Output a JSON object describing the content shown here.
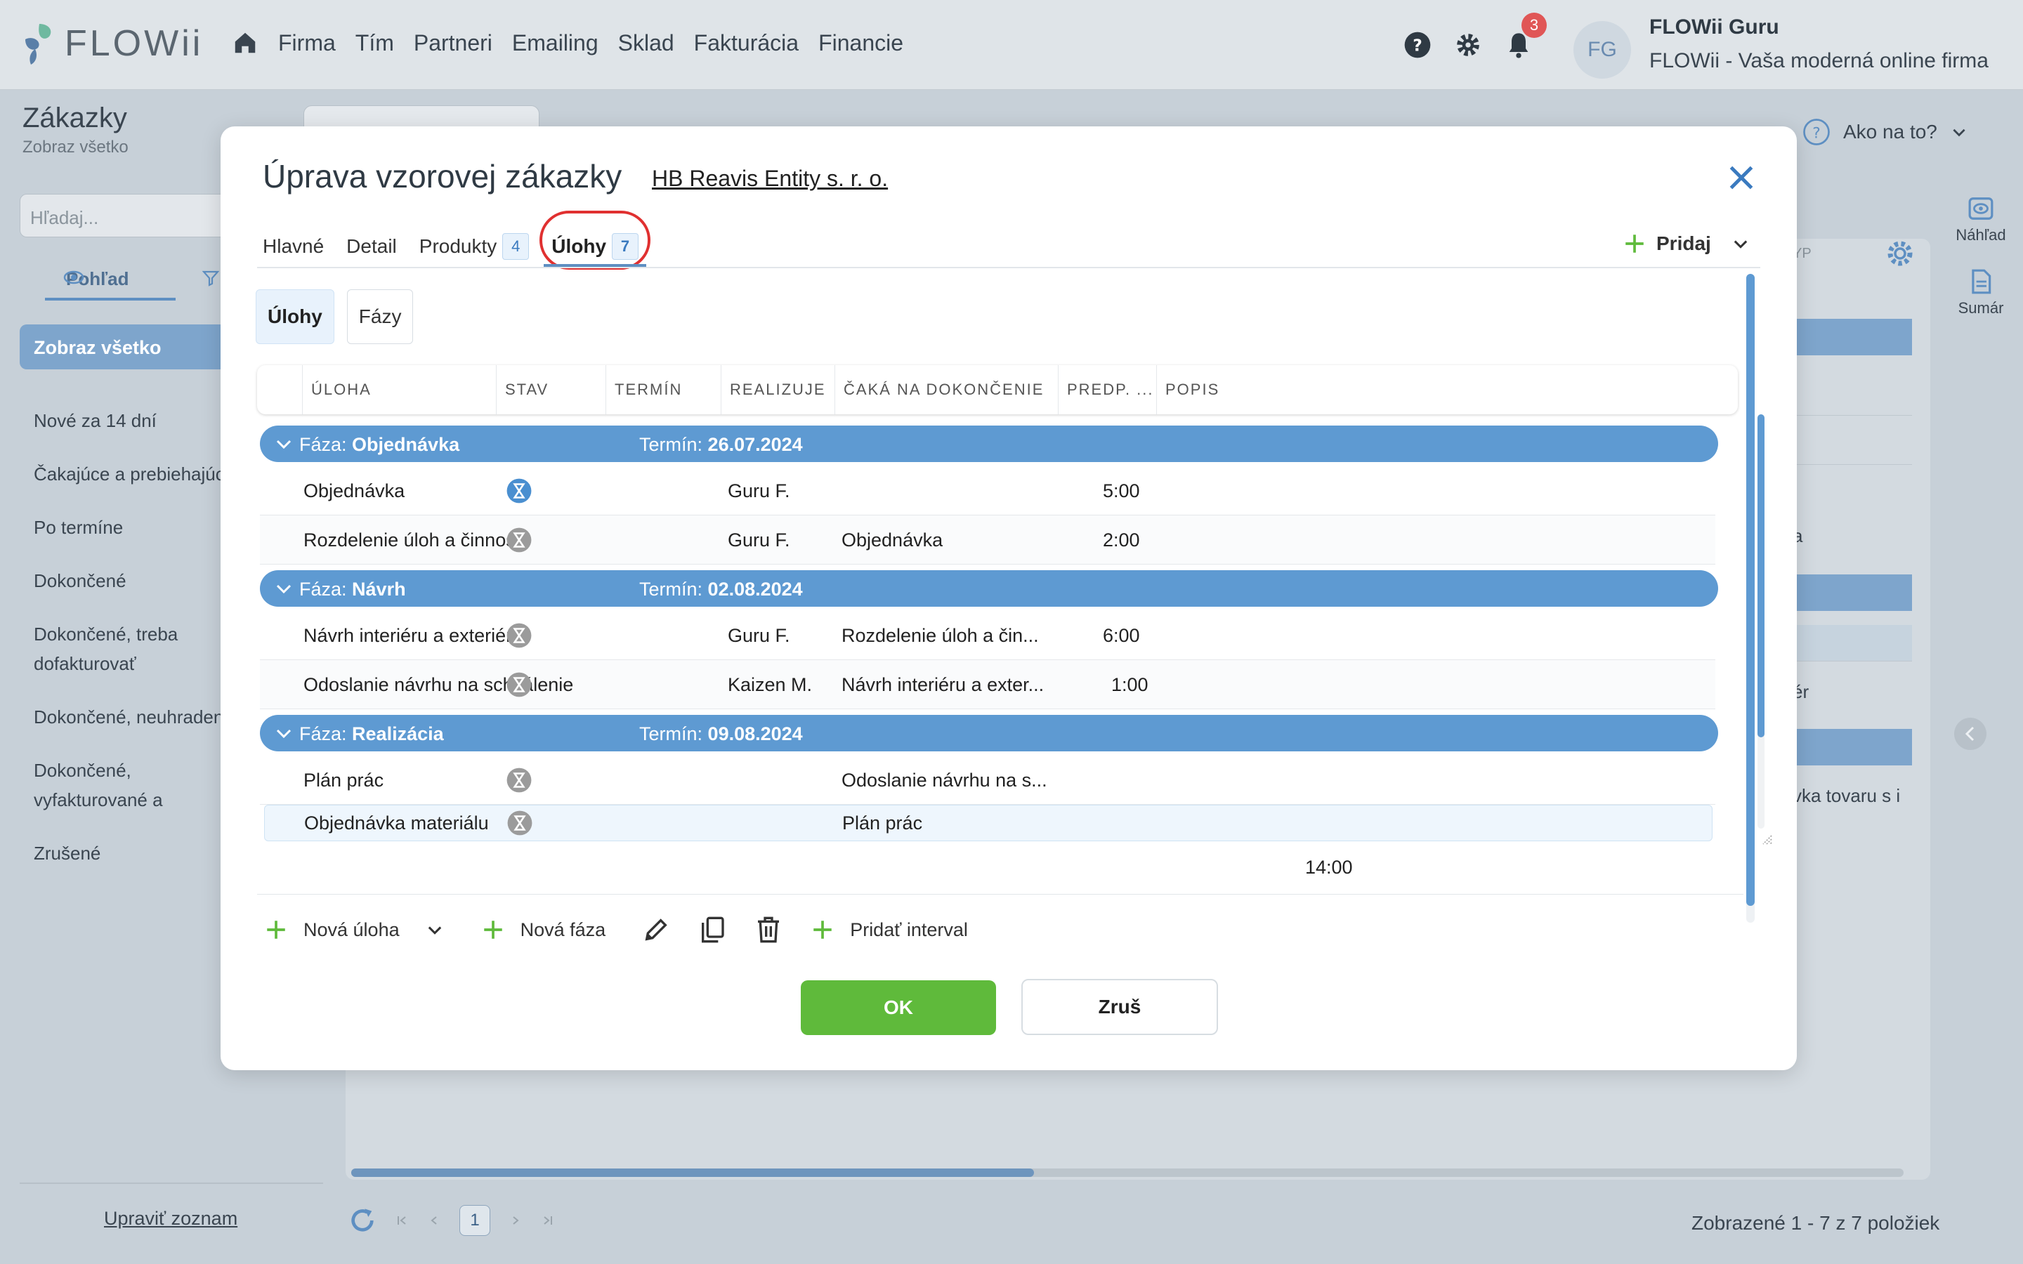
{
  "app": {
    "logo_text": "FLOWii"
  },
  "nav": {
    "items": [
      "Firma",
      "Tím",
      "Partneri",
      "Emailing",
      "Sklad",
      "Fakturácia",
      "Financie"
    ]
  },
  "notifications": {
    "count": "3"
  },
  "user": {
    "initials": "FG",
    "name": "FLOWii Guru",
    "firm": "FLOWii - Vaša moderná online firma"
  },
  "page": {
    "title": "Zákazky",
    "subtitle": "Zobraz všetko",
    "help_label": "Ako na to?",
    "search_placeholder": "Hľadaj...",
    "view_tab": "Pohľad",
    "selected_filter": "Zobraz všetko",
    "filters": [
      "Nové za 14 dní",
      "Čakajúce a prebiehajúce",
      "Po termíne",
      "Dokončené",
      "Dokončené, treba dofakturovať",
      "Dokončené, neuhradené",
      "Dokončené, vyfakturované a zaplatené",
      "Zrušené"
    ],
    "edit_list": "Upraviť zoznam",
    "right_panel": {
      "preview": "Náhľad",
      "summary": "Sumár"
    },
    "bg_texts": [
      "a",
      "ér",
      "vka tovaru s i",
      "YP"
    ],
    "pager": {
      "current_page": "1",
      "info": "Zobrazené 1 - 7 z 7 položiek"
    }
  },
  "modal": {
    "title": "Úprava vzorovej zákazky",
    "partner_link": "HB Reavis Entity s. r. o.",
    "tabs": [
      {
        "label": "Hlavné"
      },
      {
        "label": "Detail"
      },
      {
        "label": "Produkty",
        "count": "4"
      },
      {
        "label": "Úlohy",
        "count": "7"
      }
    ],
    "add_label": "Pridaj",
    "subtabs": [
      "Úlohy",
      "Fázy"
    ],
    "columns": [
      "ÚLOHA",
      "STAV",
      "TERMÍN",
      "REALIZUJE",
      "ČAKÁ NA DOKONČENIE",
      "PREDP. ...",
      "POPIS"
    ],
    "phase_prefix": "Fáza:",
    "term_prefix": "Termín:",
    "phases": [
      {
        "name": "Objednávka",
        "term": "26.07.2024",
        "rows": [
          {
            "task": "Objednávka",
            "status": "active",
            "assignee": "Guru F.",
            "waits_for": "",
            "estimate": "5:00"
          },
          {
            "task": "Rozdelenie úloh a činností",
            "status": "waiting",
            "assignee": "Guru F.",
            "waits_for": "Objednávka",
            "estimate": "2:00"
          }
        ]
      },
      {
        "name": "Návrh",
        "term": "02.08.2024",
        "rows": [
          {
            "task": "Návrh interiéru a exteriéru",
            "status": "waiting",
            "assignee": "Guru F.",
            "waits_for": "Rozdelenie úloh a čin...",
            "estimate": "6:00"
          },
          {
            "task": "Odoslanie návrhu na schválenie",
            "status": "waiting",
            "assignee": "Kaizen M.",
            "waits_for": "Návrh interiéru a exter...",
            "estimate": "1:00"
          }
        ]
      },
      {
        "name": "Realizácia",
        "term": "09.08.2024",
        "rows": [
          {
            "task": "Plán prác",
            "status": "waiting",
            "assignee": "",
            "waits_for": "Odoslanie návrhu na s...",
            "estimate": ""
          },
          {
            "task": "Objednávka materiálu",
            "status": "waiting",
            "assignee": "",
            "waits_for": "Plán prác",
            "estimate": ""
          }
        ]
      }
    ],
    "total_estimate": "14:00",
    "toolbar": {
      "new_task": "Nová úloha",
      "new_phase": "Nová fáza",
      "add_interval": "Pridať interval"
    },
    "ok_label": "OK",
    "cancel_label": "Zruš"
  },
  "colors": {
    "accent": "#5e9ad2",
    "ok_green": "#5fba3b",
    "highlight_red": "#e03030",
    "plus_green": "#5fba3b"
  }
}
